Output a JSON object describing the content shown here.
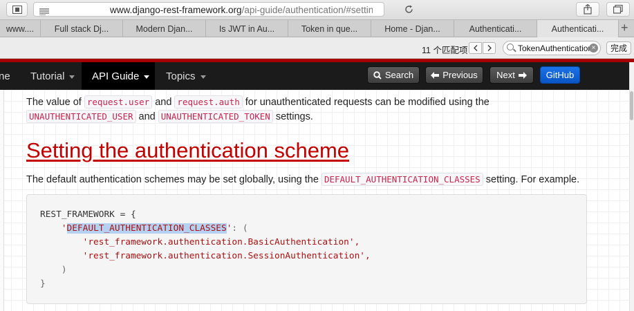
{
  "browser": {
    "url_main": "www.django-rest-framework.org",
    "url_path": "/api-guide/authentication/#setting-",
    "tabs": [
      {
        "label": "www...."
      },
      {
        "label": "Full stack Dj..."
      },
      {
        "label": "Modern Djan..."
      },
      {
        "label": "Is JWT in Au..."
      },
      {
        "label": "Token in que..."
      },
      {
        "label": "Home - Djan..."
      },
      {
        "label": "Authenticati..."
      },
      {
        "label": "Authenticati...",
        "active": true
      }
    ],
    "find": {
      "count_label": "11 个匹配项",
      "query": "TokenAuthentication",
      "done_label": "完成"
    }
  },
  "nav": {
    "home_partial": "ne",
    "tutorial": "Tutorial",
    "api_guide": "API Guide",
    "topics": "Topics",
    "search": "Search",
    "previous": "Previous",
    "next": "Next",
    "github": "GitHub"
  },
  "content": {
    "p1_a": "The value of",
    "p1_code1": "request.user",
    "p1_b": "and",
    "p1_code2": "request.auth",
    "p1_c": "for unauthenticated requests can be modified using the",
    "p2_code1": "UNAUTHENTICATED_USER",
    "p2_a": "and",
    "p2_code2": "UNAUTHENTICATED_TOKEN",
    "p2_b": "settings.",
    "heading": "Setting the authentication scheme",
    "p3_a": "The default authentication schemes may be set globally, using the",
    "p3_code": "DEFAULT_AUTHENTICATION_CLASSES",
    "p3_b": "setting. For example.",
    "code": {
      "l1": "REST_FRAMEWORK = {",
      "l2_key": "DEFAULT_AUTHENTICATION_CLASSES",
      "l3": "'rest_framework.authentication.BasicAuthentication',",
      "l4": "'rest_framework.authentication.SessionAuthentication',",
      "l5": ")",
      "l6": "}"
    }
  }
}
